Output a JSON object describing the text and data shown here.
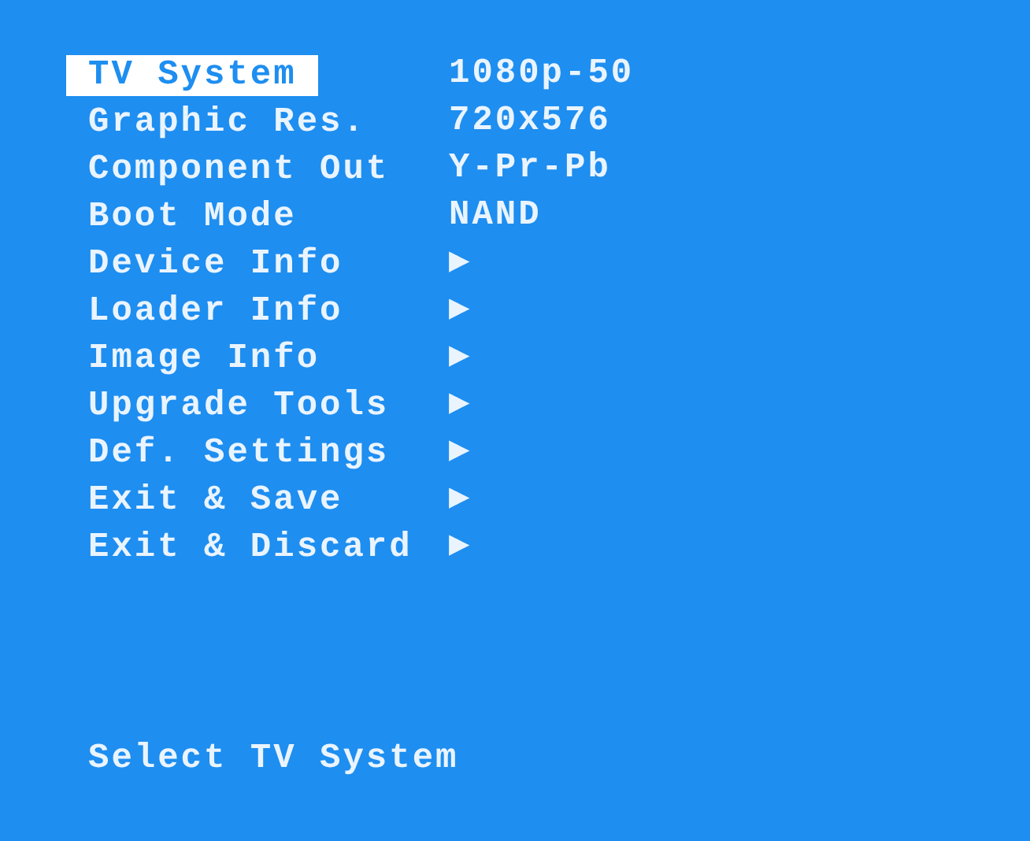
{
  "menu": [
    {
      "label": "TV System",
      "value": "1080p-50",
      "selected": true
    },
    {
      "label": "Graphic Res.",
      "value": "720x576",
      "selected": false
    },
    {
      "label": "Component Out",
      "value": "Y-Pr-Pb",
      "selected": false
    },
    {
      "label": "Boot Mode",
      "value": "NAND",
      "selected": false
    },
    {
      "label": "Device Info",
      "value": "▶",
      "selected": false
    },
    {
      "label": "Loader Info",
      "value": "▶",
      "selected": false
    },
    {
      "label": "Image Info",
      "value": "▶",
      "selected": false
    },
    {
      "label": "Upgrade Tools",
      "value": "▶",
      "selected": false
    },
    {
      "label": "Def. Settings",
      "value": "▶",
      "selected": false
    },
    {
      "label": "Exit & Save",
      "value": "▶",
      "selected": false
    },
    {
      "label": "Exit & Discard",
      "value": "▶",
      "selected": false
    }
  ],
  "help_text": "Select TV System"
}
